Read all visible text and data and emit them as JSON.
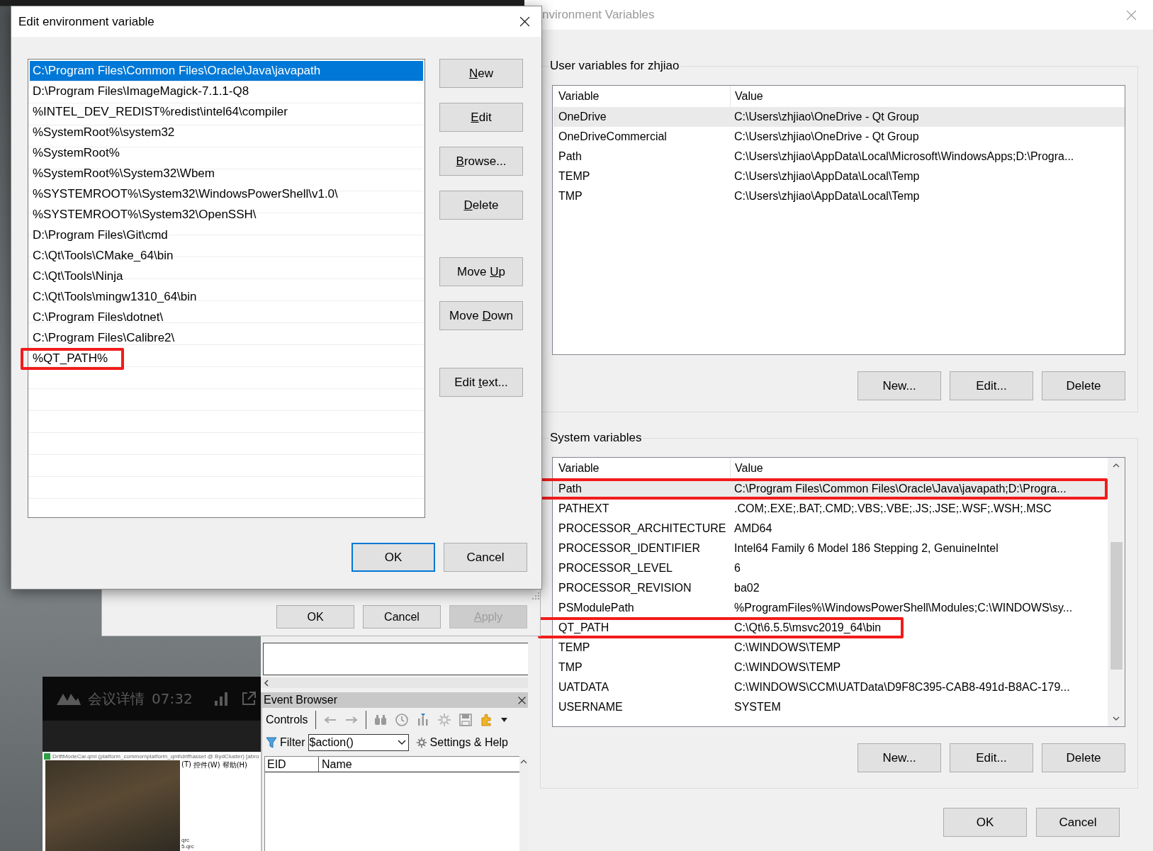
{
  "edit_dialog": {
    "title": "Edit environment variable",
    "entries": [
      {
        "text": "C:\\Program Files\\Common Files\\Oracle\\Java\\javapath",
        "selected": true
      },
      {
        "text": "D:\\Program Files\\ImageMagick-7.1.1-Q8",
        "selected": false
      },
      {
        "text": "%INTEL_DEV_REDIST%redist\\intel64\\compiler",
        "selected": false
      },
      {
        "text": "%SystemRoot%\\system32",
        "selected": false
      },
      {
        "text": "%SystemRoot%",
        "selected": false
      },
      {
        "text": "%SystemRoot%\\System32\\Wbem",
        "selected": false
      },
      {
        "text": "%SYSTEMROOT%\\System32\\WindowsPowerShell\\v1.0\\",
        "selected": false
      },
      {
        "text": "%SYSTEMROOT%\\System32\\OpenSSH\\",
        "selected": false
      },
      {
        "text": "D:\\Program Files\\Git\\cmd",
        "selected": false
      },
      {
        "text": "C:\\Qt\\Tools\\CMake_64\\bin",
        "selected": false
      },
      {
        "text": "C:\\Qt\\Tools\\Ninja",
        "selected": false
      },
      {
        "text": "C:\\Qt\\Tools\\mingw1310_64\\bin",
        "selected": false
      },
      {
        "text": "C:\\Program Files\\dotnet\\",
        "selected": false
      },
      {
        "text": "C:\\Program Files\\Calibre2\\",
        "selected": false
      },
      {
        "text": "%QT_PATH%",
        "selected": false,
        "highlighted": true
      }
    ],
    "button_groups": [
      [
        {
          "accel": "N",
          "after": "ew"
        },
        {
          "accel": "E",
          "after": "dit"
        },
        {
          "accel": "B",
          "after": "rowse..."
        },
        {
          "accel": "D",
          "after": "elete"
        }
      ],
      [
        {
          "before": "Move ",
          "accel": "U",
          "after": "p"
        },
        {
          "before": "Move ",
          "accel": "D",
          "after": "own"
        }
      ],
      [
        {
          "before": "Edit ",
          "accel": "t",
          "after": "ext..."
        }
      ]
    ],
    "footer_buttons": [
      {
        "label": "OK",
        "default": true
      },
      {
        "label": "Cancel",
        "default": false
      }
    ]
  },
  "system_properties": {
    "buttons": [
      {
        "label": "OK",
        "disabled": false
      },
      {
        "label": "Cancel",
        "disabled": false
      },
      {
        "accel": "A",
        "after": "pply",
        "disabled": true
      }
    ]
  },
  "env_window": {
    "title": "nvironment Variables",
    "user_variables": {
      "label": "User variables for zhjiao",
      "columns": [
        "Variable",
        "Value"
      ],
      "rows": [
        {
          "variable": "OneDrive",
          "value": "C:\\Users\\zhjiao\\OneDrive - Qt Group",
          "selected": true
        },
        {
          "variable": "OneDriveCommercial",
          "value": "C:\\Users\\zhjiao\\OneDrive - Qt Group",
          "selected": false
        },
        {
          "variable": "Path",
          "value": "C:\\Users\\zhjiao\\AppData\\Local\\Microsoft\\WindowsApps;D:\\Progra...",
          "selected": false
        },
        {
          "variable": "TEMP",
          "value": "C:\\Users\\zhjiao\\AppData\\Local\\Temp",
          "selected": false
        },
        {
          "variable": "TMP",
          "value": "C:\\Users\\zhjiao\\AppData\\Local\\Temp",
          "selected": false
        }
      ],
      "buttons": [
        "New...",
        "Edit...",
        "Delete"
      ]
    },
    "system_variables": {
      "label": "System variables",
      "columns": [
        "Variable",
        "Value"
      ],
      "rows": [
        {
          "variable": "Path",
          "value": "C:\\Program Files\\Common Files\\Oracle\\Java\\javapath;D:\\Progra...",
          "selected": true,
          "highlighted": true
        },
        {
          "variable": "PATHEXT",
          "value": ".COM;.EXE;.BAT;.CMD;.VBS;.VBE;.JS;.JSE;.WSF;.WSH;.MSC",
          "selected": false
        },
        {
          "variable": "PROCESSOR_ARCHITECTURE",
          "value": "AMD64",
          "selected": false
        },
        {
          "variable": "PROCESSOR_IDENTIFIER",
          "value": "Intel64 Family 6 Model 186 Stepping 2, GenuineIntel",
          "selected": false
        },
        {
          "variable": "PROCESSOR_LEVEL",
          "value": "6",
          "selected": false
        },
        {
          "variable": "PROCESSOR_REVISION",
          "value": "ba02",
          "selected": false
        },
        {
          "variable": "PSModulePath",
          "value": "%ProgramFiles%\\WindowsPowerShell\\Modules;C:\\WINDOWS\\sy...",
          "selected": false
        },
        {
          "variable": "QT_PATH",
          "value": "C:\\Qt\\6.5.5\\msvc2019_64\\bin",
          "selected": false,
          "highlighted": true
        },
        {
          "variable": "TEMP",
          "value": "C:\\WINDOWS\\TEMP",
          "selected": false
        },
        {
          "variable": "TMP",
          "value": "C:\\WINDOWS\\TEMP",
          "selected": false
        },
        {
          "variable": "UATDATA",
          "value": "C:\\WINDOWS\\CCM\\UATData\\D9F8C395-CAB8-491d-B8AC-179...",
          "selected": false
        },
        {
          "variable": "USERNAME",
          "value": "SYSTEM",
          "selected": false
        }
      ],
      "buttons": [
        "New...",
        "Edit...",
        "Delete"
      ]
    },
    "buttons": [
      "OK",
      "Cancel"
    ]
  },
  "event_browser": {
    "title": "Event Browser",
    "controls_label": "Controls",
    "filter_label": "Filter",
    "filter_value": "$action()",
    "settings_label": "Settings & Help",
    "columns": [
      "EID",
      "Name"
    ]
  },
  "meeting_window": {
    "title": "会议详情",
    "time": "07:32",
    "shared_window_title": "DriftModeCar.qml (platform_common\\platform_qml\\drift\\asset @ BydCluster) [abro",
    "menu_items": [
      "(T)",
      "控件(W)",
      "帮助(H)"
    ],
    "file_items": [
      "qrc",
      "5.qrc"
    ]
  }
}
